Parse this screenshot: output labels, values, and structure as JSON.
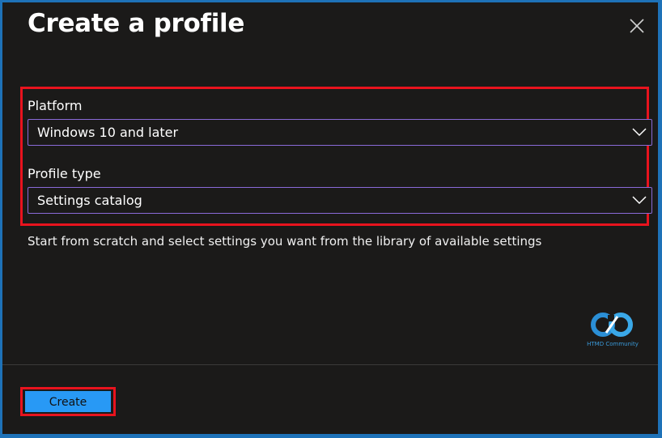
{
  "dialog": {
    "title": "Create a profile",
    "close_icon": "close-icon"
  },
  "platform": {
    "label": "Platform",
    "selected": "Windows 10 and later"
  },
  "profile_type": {
    "label": "Profile type",
    "selected": "Settings catalog"
  },
  "description": "Start from scratch and select settings you want from the library of available settings",
  "watermark": {
    "text": "HTMD Community"
  },
  "footer": {
    "create_label": "Create"
  },
  "colors": {
    "background": "#1b1a19",
    "accent_button": "#2899f5",
    "highlight": "#e8131e",
    "select_border": "#8a6ad8"
  }
}
